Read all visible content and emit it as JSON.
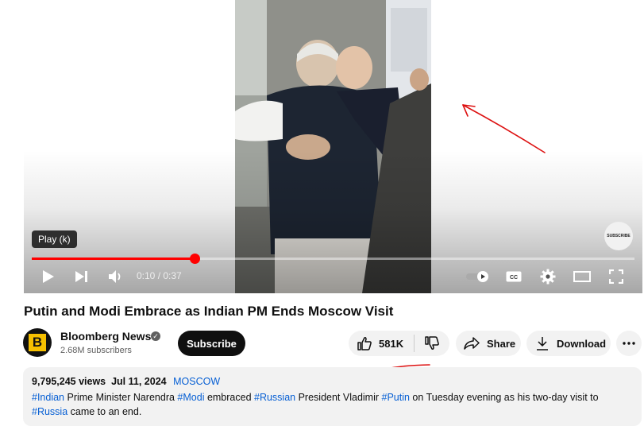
{
  "player": {
    "tooltip": "Play (k)",
    "watermark": "SUBSCRIBE",
    "time": "0:10 / 0:37",
    "progress_fraction": 0.27,
    "accent": "#ff0000"
  },
  "video": {
    "title": "Putin and Modi Embrace as Indian PM Ends Moscow Visit"
  },
  "channel": {
    "avatar_letter": "B",
    "name": "Bloomberg News",
    "subscribers": "2.68M subscribers",
    "subscribe_label": "Subscribe"
  },
  "actions": {
    "likes": "581K",
    "share_label": "Share",
    "download_label": "Download"
  },
  "description": {
    "views": "9,795,245 views",
    "date": "Jul 11, 2024",
    "location": "MOSCOW",
    "parts": {
      "t1": "#Indian",
      "s1": " Prime Minister Narendra ",
      "t2": "#Modi",
      "s2": " embraced ",
      "t3": "#Russian",
      "s3": " President Vladimir ",
      "t4": "#Putin",
      "s4": " on Tuesday evening as his two-day visit to ",
      "t5": "#Russia",
      "s5": " came to an end."
    }
  },
  "annotations": {
    "arrow_color": "#dd1111"
  }
}
